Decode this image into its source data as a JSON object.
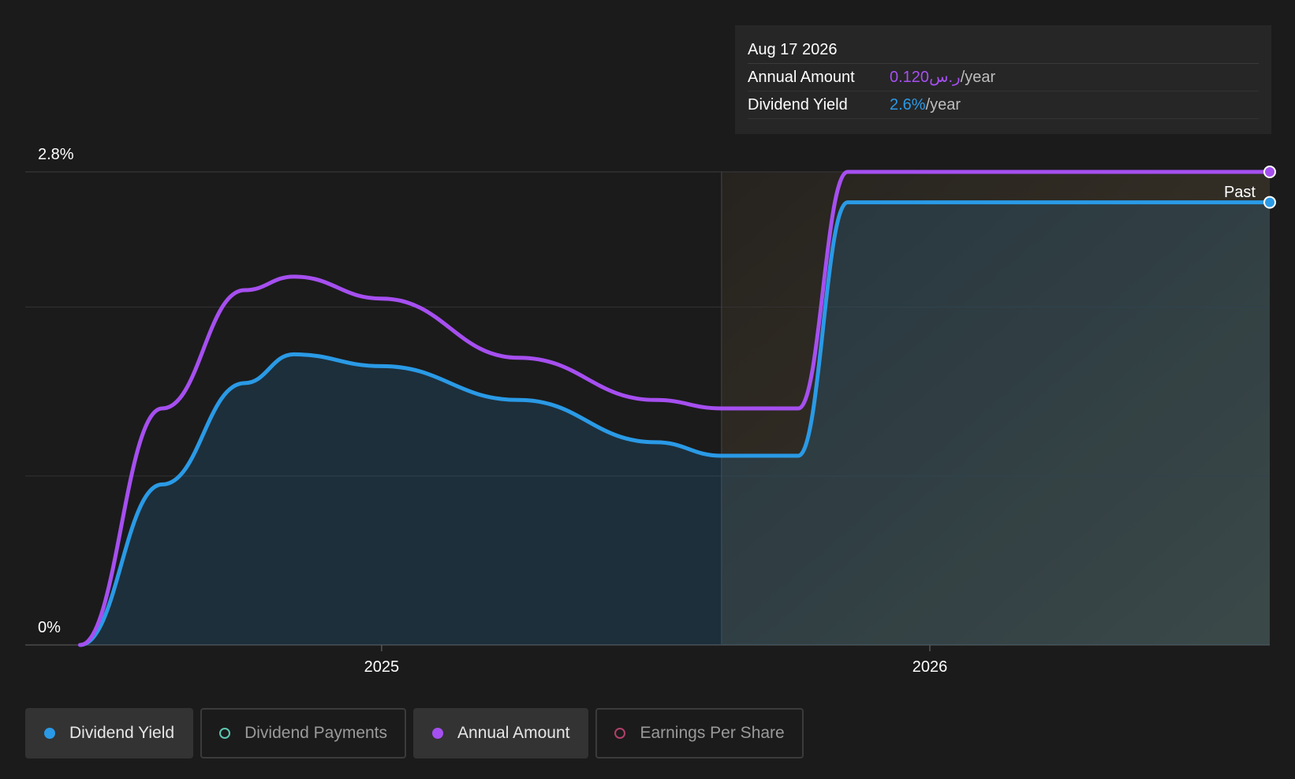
{
  "chart_data": {
    "type": "area",
    "y_tick_labels": [
      "2.8%",
      "0%"
    ],
    "x_tick_labels": [
      "2025",
      "2026"
    ],
    "ylim": [
      0,
      2.8
    ],
    "xlim": [
      2024.35,
      2026.62
    ],
    "grid": true,
    "forecast_region_label": "Past",
    "series": [
      {
        "name": "Dividend Yield",
        "color": "#2a9ae6",
        "x": [
          2024.45,
          2024.6,
          2024.75,
          2024.84,
          2025.0,
          2025.25,
          2025.5,
          2025.62,
          2025.76,
          2025.85,
          2026.62
        ],
        "values": [
          0.0,
          0.95,
          1.55,
          1.72,
          1.65,
          1.45,
          1.2,
          1.12,
          1.12,
          2.62,
          2.62
        ]
      },
      {
        "name": "Annual Amount",
        "color": "#a64ff0",
        "x": [
          2024.45,
          2024.6,
          2024.75,
          2024.84,
          2025.0,
          2025.25,
          2025.5,
          2025.62,
          2025.76,
          2025.85,
          2026.62
        ],
        "values": [
          0.0,
          1.4,
          2.1,
          2.18,
          2.05,
          1.7,
          1.45,
          1.4,
          1.4,
          2.8,
          2.8
        ]
      }
    ]
  },
  "tooltip": {
    "date": "Aug 17 2026",
    "rows": [
      {
        "label": "Annual Amount",
        "value": "0.120ر.س",
        "suffix": "/year"
      },
      {
        "label": "Dividend Yield",
        "value": "2.6%",
        "suffix": "/year"
      }
    ]
  },
  "legend": [
    {
      "label": "Dividend Yield",
      "color": "#2a9ae6",
      "active": true,
      "hollow": false
    },
    {
      "label": "Dividend Payments",
      "color": "#5cc7b0",
      "active": false,
      "hollow": true
    },
    {
      "label": "Annual Amount",
      "color": "#a64ff0",
      "active": true,
      "hollow": false
    },
    {
      "label": "Earnings Per Share",
      "color": "#b0406a",
      "active": false,
      "hollow": true
    }
  ]
}
